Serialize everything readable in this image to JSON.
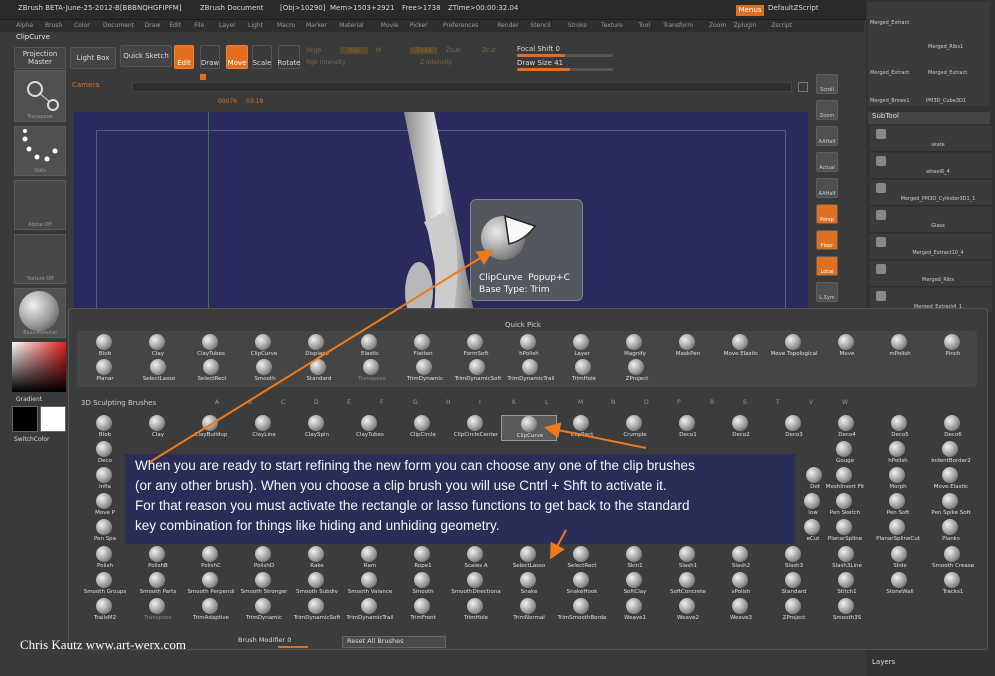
{
  "titlebar": {
    "app": "ZBrush BETA-June-25-2012-B[BBBNQHGFIPFM]",
    "document": "ZBrush Document",
    "obj": "[Obj>10290]",
    "mem": "Mem>1503+2921",
    "free": "Free>1738",
    "ztime": "ZTime>00:00:32.04",
    "menus": "Menus",
    "script": "DefaultZScript"
  },
  "menubar": [
    "Alpha",
    "Brush",
    "Color",
    "Document",
    "Draw",
    "Edit",
    "File",
    "Layer",
    "Light",
    "Macro",
    "Marker",
    "Material",
    "Movie",
    "Picker",
    "Preferences",
    "Render",
    "Stencil",
    "Stroke",
    "Texture",
    "Tool",
    "Transform",
    "Zoom",
    "Zplugin",
    "Zscript"
  ],
  "current_brush": "ClipCurve",
  "toolbar": {
    "projection_master": "Projection Master",
    "lightbox": "Light Box",
    "quick_sketch": "Quick Sketch",
    "edit": "Edit",
    "draw": "Draw",
    "move": "Move",
    "scale": "Scale",
    "rotate": "Rotate",
    "mrgb": "Mrgb",
    "rgb": "Rgb",
    "m": "M",
    "zadd": "Zadd",
    "zsub": "Zsub",
    "zcut": "Zcut",
    "rgb_intensity": "Rgb Intensity",
    "z_intensity": "Z Intensity",
    "focal_shift_label": "Focal Shift",
    "focal_shift_value": "0",
    "draw_size_label": "Draw Size",
    "draw_size_value": "41",
    "draw_size_fraction": 0.55,
    "focal_shift_fraction": 0.5
  },
  "camera": {
    "label": "Camera",
    "frame_start": "00076",
    "frame_time": "03:18"
  },
  "left_panel": {
    "transpose": "Transpose",
    "dots": "Dots",
    "alpha": "Alpha Off",
    "texture": "Texture Off",
    "material": "BasicMaterial",
    "gradient": "Gradient",
    "switch_color": "SwitchColor"
  },
  "right_buttons": [
    "Scroll",
    "Zoom",
    "AAHalf",
    "Actual",
    "AAHalf",
    "Persp",
    "Floor",
    "Local",
    "L.Sym"
  ],
  "right_panel": {
    "tools": [
      "Merged_Extract",
      "Merged_Ribs1",
      "Merged_Extract",
      "Merged_Extract",
      "Merged_Brows1",
      "PM3D_Cube3D1"
    ],
    "subtool_header": "SubTool",
    "subtools": [
      "skate",
      "wheel6_4",
      "Merged_PM3D_Cylinder3D1_1",
      "Glass",
      "Merged_Extract10_4",
      "Merged_Ribs",
      "Merged_Extract4_1"
    ],
    "layers": "Layers"
  },
  "tooltip": {
    "title": "ClipCurve",
    "shortcut": "Popup+C",
    "subtitle": "Base Type: Trim"
  },
  "quick_pick": {
    "header": "Quick Pick",
    "row1": [
      "Blob",
      "Clay",
      "ClayTubes",
      "ClipCurve",
      "Displace",
      "Elastic",
      "Flatten",
      "FormSoft",
      "hPolish",
      "Layer",
      "Magnify",
      "MaskPen",
      "Move Elastic",
      "Move Topological",
      "Move",
      "mPolish",
      "Pinch"
    ],
    "row2": [
      "Planar",
      "SelectLasso",
      "SelectRect",
      "Smooth",
      "Standard",
      "Transpose",
      "TrimDynamic",
      "TrimDynamicSoft",
      "TrimDynamicTrail",
      "TrimHole",
      "ZProject"
    ]
  },
  "sculpt": {
    "header": "3D Sculpting Brushes",
    "letters": [
      "A",
      "B",
      "C",
      "D",
      "E",
      "F",
      "G",
      "H",
      "I",
      "K",
      "L",
      "M",
      "N",
      "O",
      "P",
      "R",
      "S",
      "T",
      "V",
      "W"
    ],
    "row1": [
      "Blob",
      "Clay",
      "ClayBuildup",
      "ClayLine",
      "ClaySpin",
      "ClayTubes",
      "ClipCircle",
      "ClipCircleCenter",
      "ClipCurve",
      "ClipRect",
      "Crumple",
      "Deco1",
      "Deco2",
      "Deco3",
      "Deco4",
      "Deco5",
      "Deco6"
    ],
    "row2_visible": [
      "Deco",
      "Gouge",
      "hPolish",
      "IndentBorder2"
    ],
    "row3_visible": [
      "Infla",
      "Dot",
      "MeshInsert Fit",
      "Morph",
      "Move Elastic"
    ],
    "row4_visible": [
      "Move P",
      "low",
      "Pen Sketch",
      "Pen Soft",
      "Pen Spike Soft"
    ],
    "row5_visible": [
      "Pen Spa",
      "eCut",
      "PlanarSpline",
      "PlanarSplineCut",
      "Planks"
    ],
    "row6": [
      "Polish",
      "PolishB",
      "PolishC",
      "PolishD",
      "Rake",
      "Ram",
      "Rope1",
      "Scales A",
      "SelectLasso",
      "SelectRect",
      "Skin1",
      "Slash1",
      "Slash2",
      "Slash3",
      "Slash3Line",
      "Slide",
      "Smooth Crease"
    ],
    "row7": [
      "Smooth Groups",
      "Smooth Parts",
      "Smooth Perpendi",
      "Smooth Stronger",
      "Smooth Subdiv",
      "Smooth Valance",
      "Smooth",
      "SmoothDirectiona",
      "Snake",
      "SnakeHook",
      "SoftClay",
      "SoftConcrete",
      "sPolish",
      "Standard",
      "Stitch1",
      "StoneWall",
      "Tracks1"
    ],
    "row8": [
      "TrailsM2",
      "Transpose",
      "TrimAdaptive",
      "TrimDynamic",
      "TrimDynamicSoft",
      "TrimDynamicTrail",
      "TrimFront",
      "TrimHole",
      "TrimNormal",
      "TrimSmoothBorde",
      "Weave1",
      "Weave2",
      "Weave3",
      "ZProject",
      "Smooth3S"
    ]
  },
  "bottom_bar": {
    "brush_modifier_label": "Brush Modifier",
    "brush_modifier_value": "0",
    "reset": "Reset All Brushes"
  },
  "note": {
    "line1": "When you are ready to start refining the new form you can choose any one of the clip brushes",
    "line2": "(or any other brush). When you choose a clip brush you will use Cntrl + Shft to activate it.",
    "line3": "For that reason you must activate the rectangle or lasso functions to get back to the standard",
    "line4": "key combination for things like hiding and unhiding geometry."
  },
  "credit": "Chris Kautz www.art-werx.com",
  "colors": {
    "accent": "#e07020",
    "canvas": "#2a2a5e",
    "note_bg": "#2a2d5a"
  }
}
